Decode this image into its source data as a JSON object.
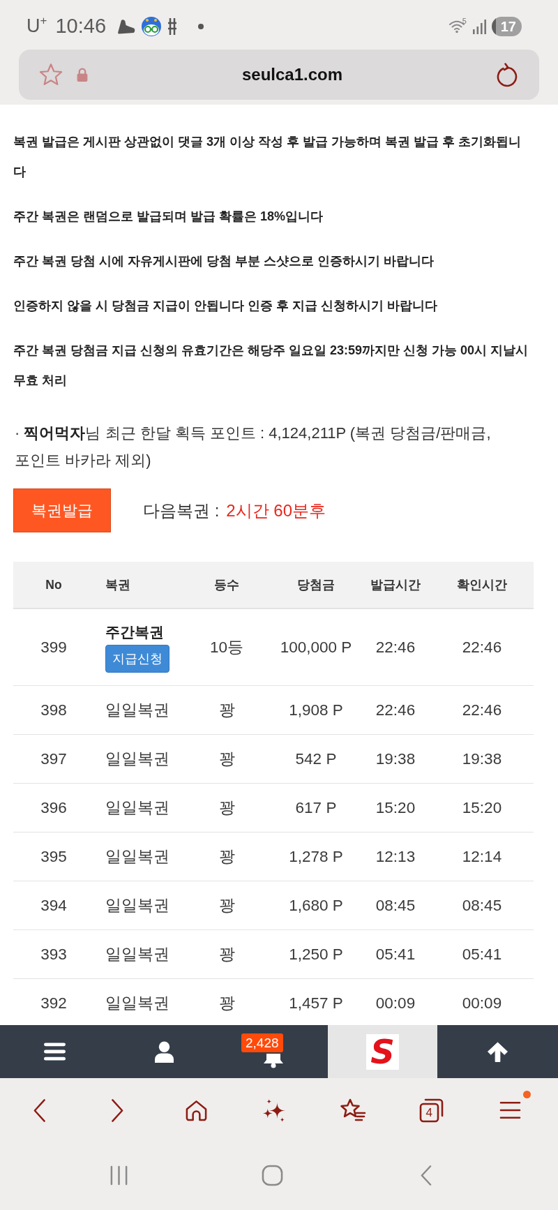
{
  "status_bar": {
    "carrier": "U$^{+}$",
    "time": "10:46",
    "wifi_band": "5",
    "battery": "17"
  },
  "address_bar": {
    "url": "seulca1.com"
  },
  "notices": [
    "복권 발급은 게시판 상관없이 댓글 3개 이상 작성 후 발급 가능하며 복권 발급 후 초기화됩니다",
    "주간 복권은 랜덤으로 발급되며 발급 확률은 18%입니다",
    "주간 복권 당첨 시에 자유게시판에 당첨 부분 스샷으로 인증하시기 바랍니다",
    "인증하지 않을 시 당첨금 지급이 안됩니다 인증 후 지급 신청하시기 바랍니다",
    "주간 복권 당첨금 지급 신청의 유효기간은 해당주 일요일 23:59까지만 신청 가능 00시 지날시 무효 처리"
  ],
  "points_summary": "· **찍어먹자**님 최근 한달 획득 포인트 : 4,124,211P (복권 당첨금/판매금, 포인트 바카라 제외)",
  "issue_button": {
    "label": "복권발급"
  },
  "next_ticket": {
    "label": "다음복권 :",
    "value": "2시간 60분후"
  },
  "table": {
    "columns": [
      "No",
      "복권",
      "등수",
      "당첨금",
      "발급시간",
      "확인시간"
    ],
    "rows": [
      {
        "no": "399",
        "kind": "weekly",
        "ticket": "주간복권",
        "action": "지급신청",
        "rank": "10등",
        "prize": "100,000 P",
        "issued_time": "22:46",
        "confirmed_time": "22:46"
      },
      {
        "no": "398",
        "kind": "daily",
        "ticket": "일일복권",
        "rank": "꽝",
        "prize": "1,908 P",
        "issued_time": "22:46",
        "confirmed_time": "22:46"
      },
      {
        "no": "397",
        "kind": "daily",
        "ticket": "일일복권",
        "rank": "꽝",
        "prize": "542 P",
        "issued_time": "19:38",
        "confirmed_time": "19:38"
      },
      {
        "no": "396",
        "kind": "daily",
        "ticket": "일일복권",
        "rank": "꽝",
        "prize": "617 P",
        "issued_time": "15:20",
        "confirmed_time": "15:20"
      },
      {
        "no": "395",
        "kind": "daily",
        "ticket": "일일복권",
        "rank": "꽝",
        "prize": "1,278 P",
        "issued_time": "12:13",
        "confirmed_time": "12:14"
      },
      {
        "no": "394",
        "kind": "daily",
        "ticket": "일일복권",
        "rank": "꽝",
        "prize": "1,680 P",
        "issued_time": "08:45",
        "confirmed_time": "08:45"
      },
      {
        "no": "393",
        "kind": "daily",
        "ticket": "일일복권",
        "rank": "꽝",
        "prize": "1,250 P",
        "issued_time": "05:41",
        "confirmed_time": "05:41"
      },
      {
        "no": "392",
        "kind": "daily",
        "ticket": "일일복권",
        "rank": "꽝",
        "prize": "1,457 P",
        "issued_time": "00:09",
        "confirmed_time": "00:09"
      }
    ]
  },
  "bottom_nav": {
    "items": [
      {
        "kind": "menu"
      },
      {
        "kind": "user"
      },
      {
        "kind": "alerts",
        "badge": "2,428"
      },
      {
        "kind": "logo",
        "text": "S"
      },
      {
        "kind": "top"
      }
    ]
  },
  "browser_toolbar": {
    "items": [
      {
        "kind": "back",
        "notification": false
      },
      {
        "kind": "forward",
        "notification": false
      },
      {
        "kind": "home",
        "notification": false
      },
      {
        "kind": "sparkle",
        "notification": false
      },
      {
        "kind": "bookmarks",
        "notification": false
      },
      {
        "kind": "tabs",
        "count": "4",
        "notification": false
      },
      {
        "kind": "menu",
        "notification": true
      }
    ]
  }
}
